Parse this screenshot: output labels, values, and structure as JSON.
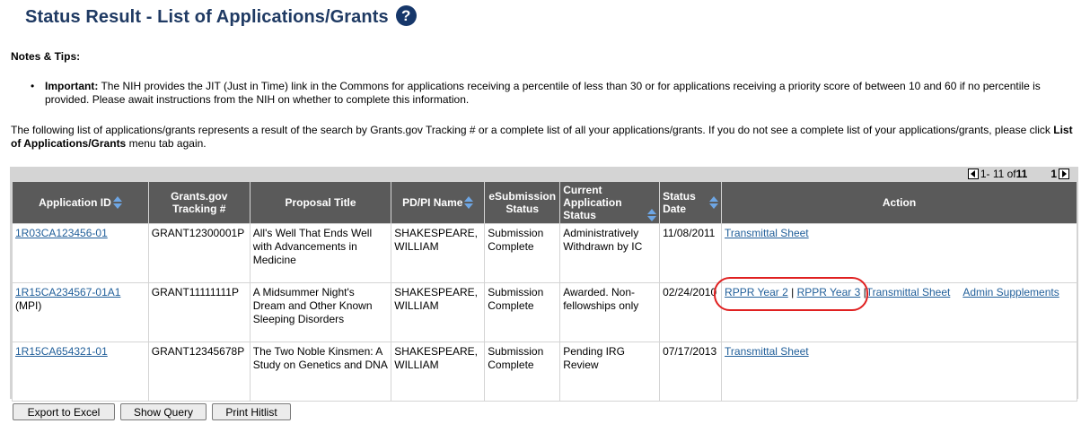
{
  "page": {
    "title": "Status Result - List of Applications/Grants",
    "help_icon": "?"
  },
  "notes": {
    "heading": "Notes & Tips:",
    "items": [
      {
        "label": "Important:",
        "text": " The NIH provides the JIT (Just in Time) link in the Commons for applications receiving a percentile of less than 30 or for applications receiving a priority score of between 10 and 60 if no percentile is provided.  Please await instructions from the NIH on whether to complete this information."
      }
    ]
  },
  "intro": {
    "text": "The following list of applications/grants represents a result of the search by Grants.gov Tracking # or a complete list of all your applications/grants. If you do not see a complete list of your applications/grants, please click ",
    "bold": "List of Applications/Grants",
    "tail": " menu tab again."
  },
  "pager": {
    "range": "1- 11 of ",
    "total": "11",
    "page": "1"
  },
  "table": {
    "headers": {
      "application_id": "Application ID",
      "tracking_1": "Grants.gov",
      "tracking_2": "Tracking #",
      "proposal_title": "Proposal Title",
      "pdpi": "PD/PI Name",
      "esub_1": "eSubmission",
      "esub_2": "Status",
      "current_1": "Current",
      "current_2": "Application",
      "current_3": "Status",
      "status_date_1": "Status",
      "status_date_2": "Date",
      "action": "Action"
    },
    "rows": [
      {
        "app_id": "1R03CA123456-01",
        "app_suffix": "",
        "tracking": "GRANT12300001P",
        "title": "All's Well That Ends Well with Advancements in Medicine",
        "pdpi": "SHAKESPEARE, WILLIAM",
        "esub": "Submission Complete",
        "current": "Administratively Withdrawn by IC",
        "date": "11/08/2011",
        "actions": {
          "transmittal": "Transmittal Sheet"
        }
      },
      {
        "app_id": "1R15CA234567-01A1",
        "app_suffix": " (MPI)",
        "tracking": "GRANT11111111P",
        "title": "A Midsummer Night's Dream and Other Known Sleeping Disorders",
        "pdpi": "SHAKESPEARE, WILLIAM",
        "esub": "Submission Complete",
        "current": "Awarded. Non-fellowships only",
        "date": "02/24/2010",
        "actions": {
          "rppr2": "RPPR Year 2",
          "sep": " | ",
          "rppr3": "RPPR Year 3",
          "sep2": " |",
          "transmittal": "Transmittal Sheet",
          "admin": "Admin Supplements"
        }
      },
      {
        "app_id": "1R15CA654321-01",
        "app_suffix": "",
        "tracking": "GRANT12345678P",
        "title": "The Two Noble Kinsmen: A Study on Genetics and DNA",
        "pdpi": "SHAKESPEARE, WILLIAM",
        "esub": "Submission Complete",
        "current": "Pending IRG Review",
        "date": "07/17/2013",
        "actions": {
          "transmittal": "Transmittal Sheet"
        }
      }
    ]
  },
  "buttons": {
    "export": "Export to Excel",
    "query": "Show Query",
    "print": "Print Hitlist"
  },
  "colors": {
    "title": "#1f3a63",
    "header_bg": "#5a5a5a",
    "link": "#215f9a",
    "highlight": "#e02020"
  }
}
